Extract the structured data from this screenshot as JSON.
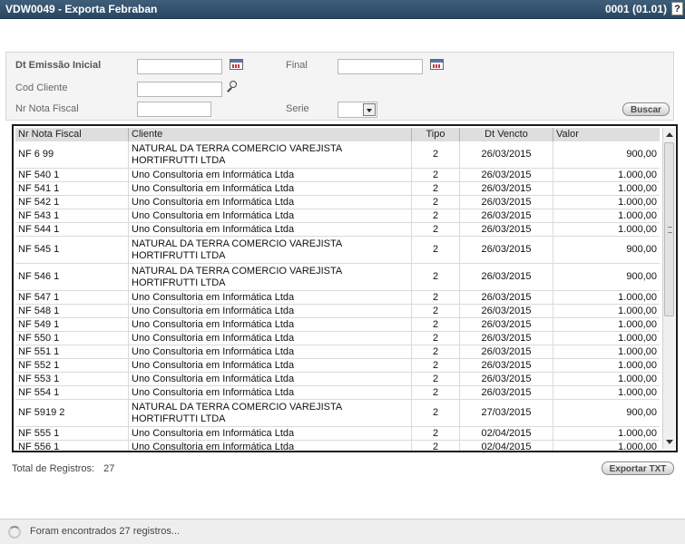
{
  "window": {
    "title": "VDW0049 - Exporta Febraban",
    "version": "0001 (01.01)",
    "help_label": "?"
  },
  "filters": {
    "dt_emissao_label": "Dt Emissão Inicial",
    "final_label": "Final",
    "cod_cliente_label": "Cod Cliente",
    "nr_nota_label": "Nr Nota Fiscal",
    "serie_label": "Serie",
    "dt_emissao_value": "",
    "final_value": "",
    "cod_cliente_value": "",
    "nr_nota_value": "",
    "serie_value": "",
    "buscar_label": "Buscar"
  },
  "grid": {
    "columns": [
      "Nr Nota Fiscal",
      "Cliente",
      "Tipo",
      "Dt Vencto",
      "Valor"
    ],
    "rows": [
      [
        "NF 6 99",
        "NATURAL DA TERRA COMERCIO VAREJISTA HORTIFRUTTI LTDA",
        "2",
        "26/03/2015",
        "900,00"
      ],
      [
        "NF 540 1",
        "Uno Consultoria em Informática Ltda",
        "2",
        "26/03/2015",
        "1.000,00"
      ],
      [
        "NF 541 1",
        "Uno Consultoria em Informática Ltda",
        "2",
        "26/03/2015",
        "1.000,00"
      ],
      [
        "NF 542 1",
        "Uno Consultoria em Informática Ltda",
        "2",
        "26/03/2015",
        "1.000,00"
      ],
      [
        "NF 543 1",
        "Uno Consultoria em Informática Ltda",
        "2",
        "26/03/2015",
        "1.000,00"
      ],
      [
        "NF 544 1",
        "Uno Consultoria em Informática Ltda",
        "2",
        "26/03/2015",
        "1.000,00"
      ],
      [
        "NF 545 1",
        "NATURAL DA TERRA COMERCIO VAREJISTA HORTIFRUTTI LTDA",
        "2",
        "26/03/2015",
        "900,00"
      ],
      [
        "NF 546 1",
        "NATURAL DA TERRA COMERCIO VAREJISTA HORTIFRUTTI LTDA",
        "2",
        "26/03/2015",
        "900,00"
      ],
      [
        "NF 547 1",
        "Uno Consultoria em Informática Ltda",
        "2",
        "26/03/2015",
        "1.000,00"
      ],
      [
        "NF 548 1",
        "Uno Consultoria em Informática Ltda",
        "2",
        "26/03/2015",
        "1.000,00"
      ],
      [
        "NF 549 1",
        "Uno Consultoria em Informática Ltda",
        "2",
        "26/03/2015",
        "1.000,00"
      ],
      [
        "NF 550 1",
        "Uno Consultoria em Informática Ltda",
        "2",
        "26/03/2015",
        "1.000,00"
      ],
      [
        "NF 551 1",
        "Uno Consultoria em Informática Ltda",
        "2",
        "26/03/2015",
        "1.000,00"
      ],
      [
        "NF 552 1",
        "Uno Consultoria em Informática Ltda",
        "2",
        "26/03/2015",
        "1.000,00"
      ],
      [
        "NF 553 1",
        "Uno Consultoria em Informática Ltda",
        "2",
        "26/03/2015",
        "1.000,00"
      ],
      [
        "NF 554 1",
        "Uno Consultoria em Informática Ltda",
        "2",
        "26/03/2015",
        "1.000,00"
      ],
      [
        "NF 5919 2",
        "NATURAL DA TERRA COMERCIO VAREJISTA HORTIFRUTTI LTDA",
        "2",
        "27/03/2015",
        "900,00"
      ],
      [
        "NF 555 1",
        "Uno Consultoria em Informática Ltda",
        "2",
        "02/04/2015",
        "1.000,00"
      ],
      [
        "NF 556 1",
        "Uno Consultoria em Informática Ltda",
        "2",
        "02/04/2015",
        "1.000,00"
      ]
    ]
  },
  "footer": {
    "total_label": "Total de Registros:",
    "total_value": "27",
    "export_label": "Exportar TXT"
  },
  "status": {
    "message": "Foram encontrados 27 registros..."
  },
  "icons": {
    "calendar": "calendar-icon",
    "search": "search-icon",
    "dropdown": "chevron-down-icon",
    "spinner": "loading-spinner-icon"
  }
}
